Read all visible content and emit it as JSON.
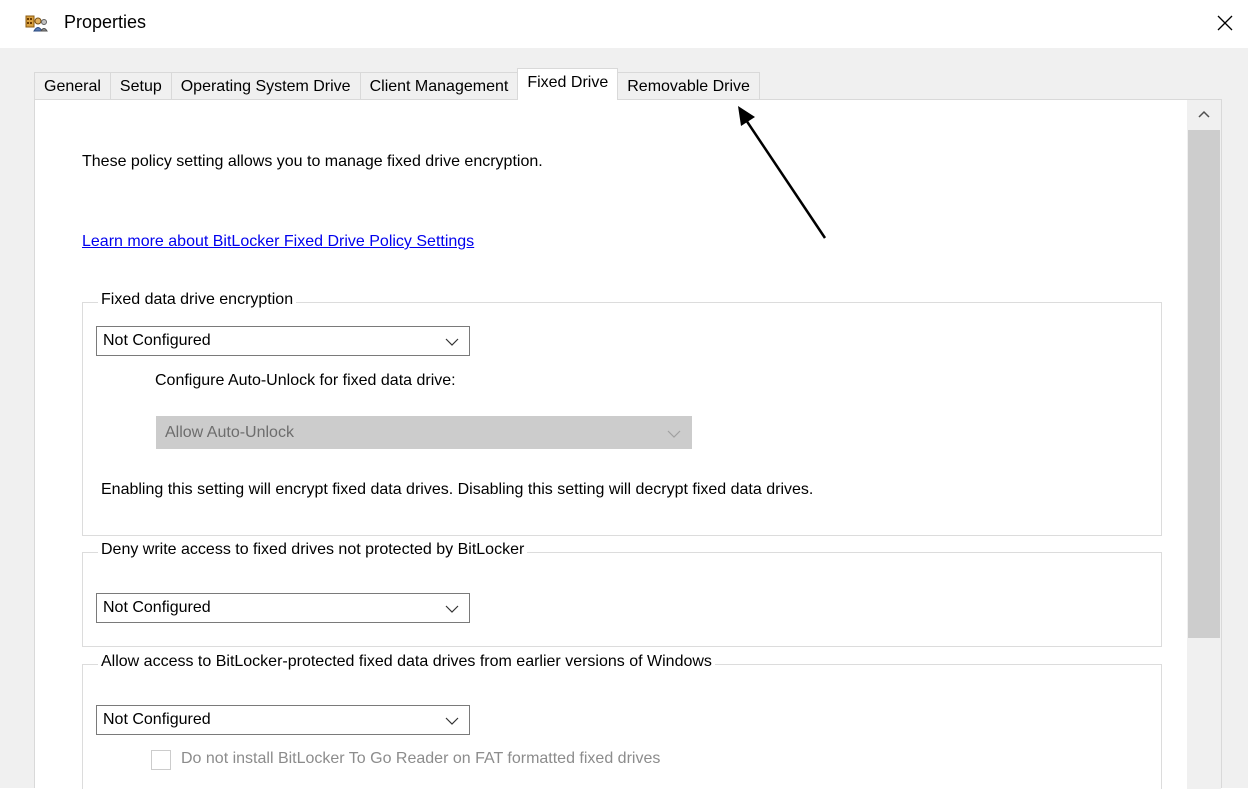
{
  "window": {
    "title": "Properties",
    "icon": "key-users-icon",
    "close_icon": "close-icon"
  },
  "tabs": [
    {
      "label": "General",
      "active": false
    },
    {
      "label": "Setup",
      "active": false
    },
    {
      "label": "Operating System Drive",
      "active": false
    },
    {
      "label": "Client Management",
      "active": false
    },
    {
      "label": "Fixed Drive",
      "active": true
    },
    {
      "label": "Removable Drive",
      "active": false
    }
  ],
  "content": {
    "intro": "These policy setting allows you to manage fixed drive encryption.",
    "learn_more_link": "Learn more about BitLocker Fixed Drive Policy Settings",
    "groups": {
      "encryption": {
        "title": "Fixed data drive encryption",
        "select_value": "Not Configured",
        "auto_unlock_label": "Configure Auto-Unlock for fixed data drive:",
        "auto_unlock_value": "Allow Auto-Unlock",
        "auto_unlock_disabled": true,
        "description": "Enabling this setting will encrypt fixed data drives. Disabling this setting will decrypt fixed data drives."
      },
      "deny_write": {
        "title": "Deny write access to fixed drives not protected by BitLocker",
        "select_value": "Not Configured"
      },
      "allow_access": {
        "title": "Allow access to BitLocker-protected fixed data drives from earlier versions of Windows",
        "select_value": "Not Configured",
        "checkbox_label": "Do not install BitLocker To Go Reader on FAT formatted fixed drives",
        "checkbox_checked": false,
        "checkbox_disabled": true
      }
    }
  },
  "colors": {
    "link": "#0000ee",
    "disabled_fill": "#cccccc",
    "dialog_bg": "#f0f0f0"
  }
}
